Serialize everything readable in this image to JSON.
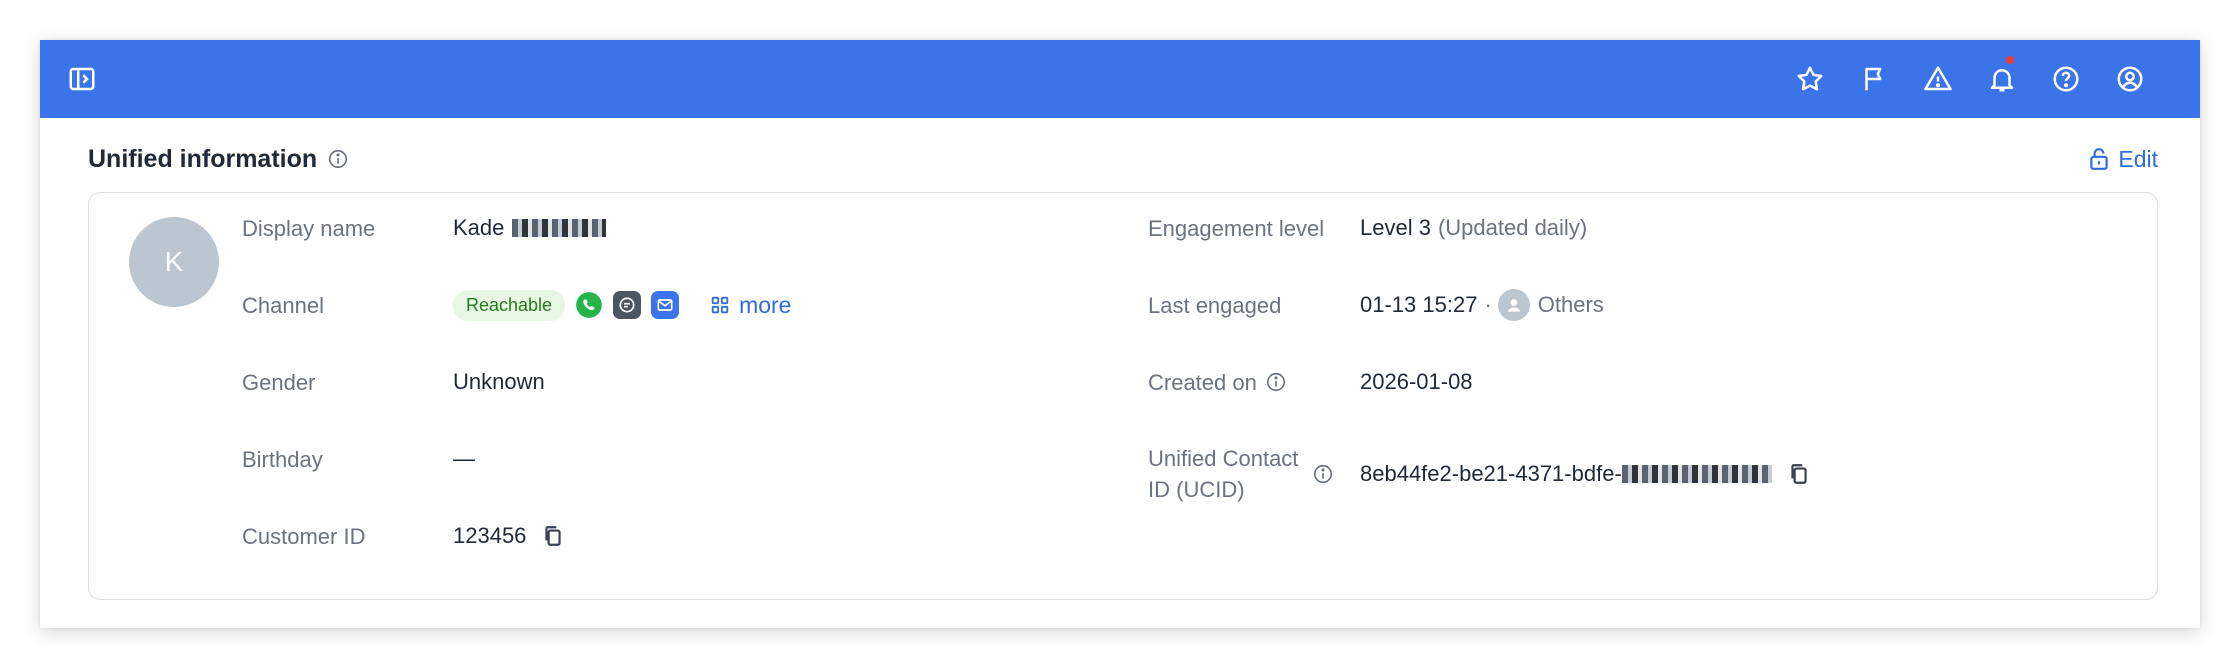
{
  "header": {
    "icons": [
      "sidebar-toggle-icon",
      "star-icon",
      "flag-icon",
      "warning-icon",
      "bell-icon",
      "help-icon",
      "user-circle-icon"
    ],
    "accent_color": "#3b73e8",
    "notification_dot_color": "#ef3b2d"
  },
  "section": {
    "title": "Unified information",
    "edit_label": "Edit"
  },
  "profile": {
    "avatar_initial": "K",
    "fields_left": {
      "display_name": {
        "label": "Display name",
        "value": "Kade"
      },
      "channel": {
        "label": "Channel",
        "badge": "Reachable",
        "more_label": "more",
        "icons": [
          "whatsapp-icon",
          "chat-icon",
          "email-icon",
          "apps-grid-icon"
        ]
      },
      "gender": {
        "label": "Gender",
        "value": "Unknown"
      },
      "birthday": {
        "label": "Birthday",
        "value": "—"
      },
      "customer_id": {
        "label": "Customer ID",
        "value": "123456"
      }
    },
    "fields_right": {
      "engagement_level": {
        "label": "Engagement level",
        "value": "Level 3",
        "note": "(Updated daily)"
      },
      "last_engaged": {
        "label": "Last engaged",
        "time": "01-13 15:27",
        "separator": "·",
        "by": "Others"
      },
      "created_on": {
        "label": "Created on",
        "value": "2026-01-08"
      },
      "ucid": {
        "label_line1": "Unified Contact",
        "label_line2": "ID (UCID)",
        "value": "8eb44fe2-be21-4371-bdfe-"
      }
    }
  },
  "colors": {
    "badge_bg": "#e8f6e4",
    "badge_text": "#277a1f",
    "whatsapp": "#25b34a",
    "chat": "#4b5563",
    "email": "#3b73e8",
    "link": "#2f6ce0"
  }
}
